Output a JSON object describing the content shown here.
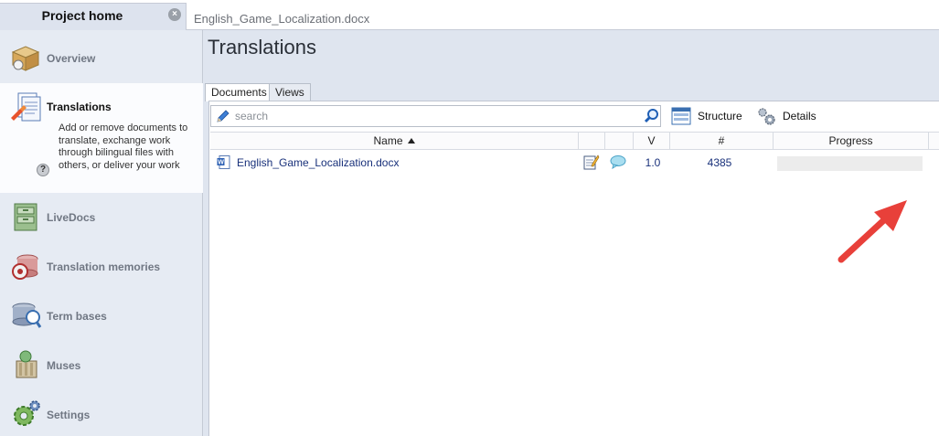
{
  "tabs": {
    "active": {
      "label": "Project home"
    },
    "document": {
      "label": "English_Game_Localization.docx"
    }
  },
  "sidebar": {
    "items": [
      {
        "label": "Overview",
        "icon": "box-icon"
      },
      {
        "label": "Translations",
        "icon": "documents-icon",
        "active": true,
        "description": "Add or remove documents to translate, exchange work through bilingual files with others, or deliver your work"
      },
      {
        "label": "LiveDocs",
        "icon": "cabinet-icon"
      },
      {
        "label": "Translation memories",
        "icon": "tm-icon"
      },
      {
        "label": "Term bases",
        "icon": "termbase-icon"
      },
      {
        "label": "Muses",
        "icon": "muse-icon"
      },
      {
        "label": "Settings",
        "icon": "gear-icon"
      }
    ]
  },
  "main": {
    "title": "Translations",
    "subtabs": [
      "Documents",
      "Views"
    ],
    "search": {
      "placeholder": "search",
      "value": ""
    },
    "toolbar": {
      "structure_label": "Structure",
      "details_label": "Details"
    },
    "columns": {
      "name": "Name",
      "version": "V",
      "count": "#",
      "progress": "Progress"
    },
    "rows": [
      {
        "name": "English_Game_Localization.docx",
        "version": "1.0",
        "count": "4385",
        "progress": 0
      }
    ]
  },
  "colors": {
    "sidebar_bg": "#e6ebf3",
    "main_bg": "#dfe5ef",
    "link_text": "#18307a",
    "annotation_arrow": "#e8403a"
  }
}
